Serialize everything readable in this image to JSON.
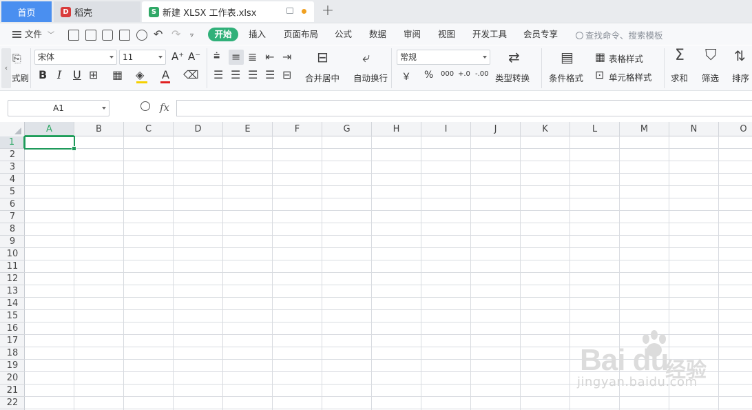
{
  "tabs": {
    "home": "首页",
    "daoke": "稻壳",
    "file": "新建 XLSX 工作表.xlsx",
    "daoke_badge": "D",
    "file_badge": "S",
    "new_tab": "+"
  },
  "menu": {
    "file": "文件",
    "start": "开始",
    "items": [
      "插入",
      "页面布局",
      "公式",
      "数据",
      "审阅",
      "视图",
      "开发工具",
      "会员专享"
    ],
    "search": "查找命令、搜索模板"
  },
  "ribbon": {
    "format_painter": "式刷",
    "font_name": "宋体",
    "font_size": "11",
    "grow_font": "A⁺",
    "shrink_font": "A⁻",
    "bold": "B",
    "italic": "I",
    "underline": "U",
    "font_color": "A",
    "merge_center": "合并居中",
    "auto_wrap": "自动换行",
    "number_format": "常规",
    "currency": "￥",
    "percent": "%",
    "thousands": "000",
    "inc_decimal": "+.0",
    "dec_decimal": "-.00",
    "type_convert": "类型转换",
    "cond_format": "条件格式",
    "table_style": "表格样式",
    "cell_style": "单元格样式",
    "sum": "求和",
    "filter": "筛选",
    "sort": "排序"
  },
  "formula": {
    "name_box": "A1",
    "fx": "fx",
    "value": ""
  },
  "grid": {
    "columns": [
      "A",
      "B",
      "C",
      "D",
      "E",
      "F",
      "G",
      "H",
      "I",
      "J",
      "K",
      "L",
      "M",
      "N",
      "O"
    ],
    "rows": [
      "1",
      "2",
      "3",
      "4",
      "5",
      "6",
      "7",
      "8",
      "9",
      "10",
      "11",
      "12",
      "13",
      "14",
      "15",
      "16",
      "17",
      "18",
      "19",
      "20",
      "21",
      "22"
    ],
    "selected_column": "A",
    "selected_row": "1"
  },
  "colors": {
    "accent_green": "#30b079",
    "home_tab_blue": "#4a8ff0",
    "active_cell": "#1e9a5b"
  },
  "watermark": {
    "brand": "Bai du",
    "cn": "经验",
    "url": "jingyan.baidu.com"
  }
}
